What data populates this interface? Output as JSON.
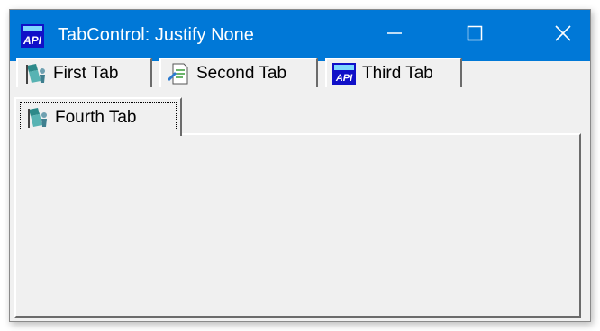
{
  "window": {
    "title": "TabControl: Justify None",
    "app_icon": "api-icon",
    "controls": {
      "minimize_icon": "minimize-icon",
      "maximize_icon": "maximize-icon",
      "close_icon": "close-icon"
    },
    "titlebar_color": "#0078d7"
  },
  "tabs": [
    {
      "label": "First Tab",
      "icon": "flag-person-icon"
    },
    {
      "label": "Second Tab",
      "icon": "document-icon"
    },
    {
      "label": "Third Tab",
      "icon": "api-icon"
    },
    {
      "label": "Fourth Tab",
      "icon": "flag-person-icon",
      "selected": true,
      "focused": true
    }
  ]
}
